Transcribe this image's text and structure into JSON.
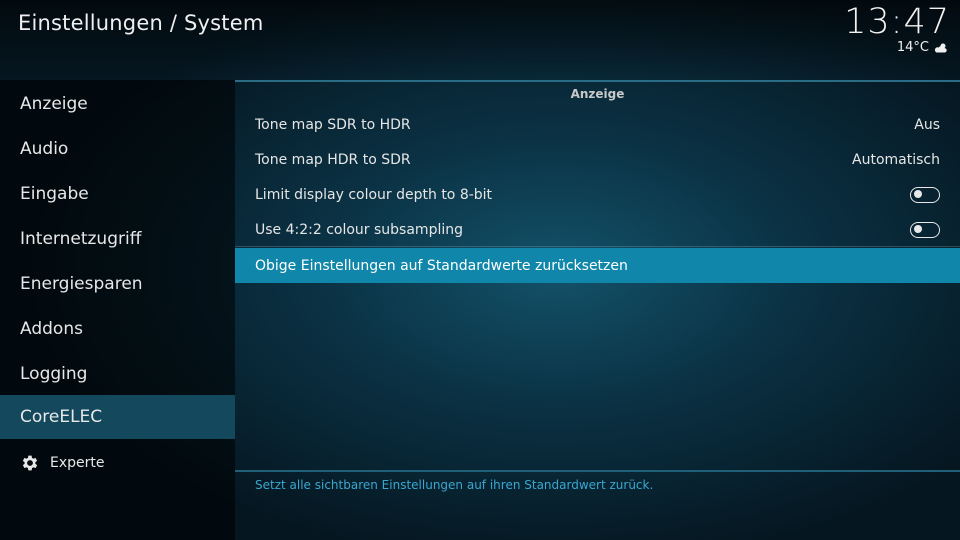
{
  "header": {
    "title": "Einstellungen / System",
    "clock": "13:47",
    "temperature": "14°C",
    "weather_icon": "partly-cloudy-icon"
  },
  "sidebar": {
    "items": [
      {
        "label": "Anzeige",
        "active": false
      },
      {
        "label": "Audio",
        "active": false
      },
      {
        "label": "Eingabe",
        "active": false
      },
      {
        "label": "Internetzugriff",
        "active": false
      },
      {
        "label": "Energiesparen",
        "active": false
      },
      {
        "label": "Addons",
        "active": false
      },
      {
        "label": "Logging",
        "active": false
      },
      {
        "label": "CoreELEC",
        "active": true
      }
    ],
    "level": {
      "label": "Experte",
      "icon": "gear-icon"
    }
  },
  "panel": {
    "section_title": "Anzeige",
    "settings": [
      {
        "label": "Tone map SDR to HDR",
        "value": "Aus"
      },
      {
        "label": "Tone map HDR to SDR",
        "value": "Automatisch"
      },
      {
        "label": "Limit display colour depth to 8-bit",
        "toggle": false
      },
      {
        "label": "Use 4:2:2 colour subsampling",
        "toggle": false
      }
    ],
    "reset_label": "Obige Einstellungen auf Standardwerte zurücksetzen",
    "description": "Setzt alle sichtbaren Einstellungen auf ihren Standardwert zurück."
  },
  "colors": {
    "accent": "#1087aa",
    "sidebar_active": "#14485c",
    "description_text": "#3aa7cf"
  }
}
